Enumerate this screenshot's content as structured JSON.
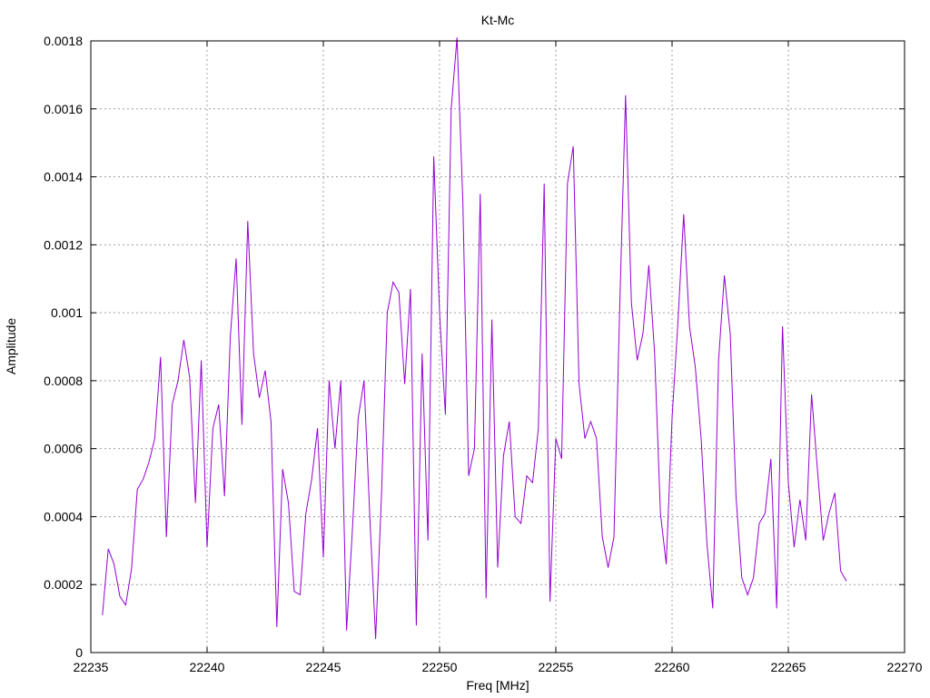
{
  "chart_data": {
    "type": "line",
    "title": "Kt-Mc",
    "xlabel": "Freq [MHz]",
    "ylabel": "Amplitude",
    "xlim": [
      22235,
      22270
    ],
    "ylim": [
      0,
      0.0018
    ],
    "grid": true,
    "x_ticks": [
      "22235",
      "22240",
      "22245",
      "22250",
      "22255",
      "22260",
      "22265",
      "22270"
    ],
    "y_ticks": [
      "0",
      "0.0002",
      "0.0004",
      "0.0006",
      "0.0008",
      "0.001",
      "0.0012",
      "0.0014",
      "0.0016",
      "0.0018"
    ],
    "series": [
      {
        "color": "#9400d3",
        "x": [
          22235.5,
          22235.75,
          22236.0,
          22236.25,
          22236.5,
          22236.75,
          22237.0,
          22237.25,
          22237.5,
          22237.75,
          22238.0,
          22238.25,
          22238.5,
          22238.75,
          22239.0,
          22239.25,
          22239.5,
          22239.75,
          22240.0,
          22240.25,
          22240.5,
          22240.75,
          22241.0,
          22241.25,
          22241.5,
          22241.75,
          22242.0,
          22242.25,
          22242.5,
          22242.75,
          22243.0,
          22243.25,
          22243.5,
          22243.75,
          22244.0,
          22244.25,
          22244.5,
          22244.75,
          22245.0,
          22245.25,
          22245.5,
          22245.75,
          22246.0,
          22246.25,
          22246.5,
          22246.75,
          22247.0,
          22247.25,
          22247.5,
          22247.75,
          22248.0,
          22248.25,
          22248.5,
          22248.75,
          22249.0,
          22249.25,
          22249.5,
          22249.75,
          22250.0,
          22250.25,
          22250.5,
          22250.75,
          22251.0,
          22251.25,
          22251.5,
          22251.75,
          22252.0,
          22252.25,
          22252.5,
          22252.75,
          22253.0,
          22253.25,
          22253.5,
          22253.75,
          22254.0,
          22254.25,
          22254.5,
          22254.75,
          22255.0,
          22255.25,
          22255.5,
          22255.75,
          22256.0,
          22256.25,
          22256.5,
          22256.75,
          22257.0,
          22257.25,
          22257.5,
          22257.75,
          22258.0,
          22258.25,
          22258.5,
          22258.75,
          22259.0,
          22259.25,
          22259.5,
          22259.75,
          22260.0,
          22260.25,
          22260.5,
          22260.75,
          22261.0,
          22261.25,
          22261.5,
          22261.75,
          22262.0,
          22262.25,
          22262.5,
          22262.75,
          22263.0,
          22263.25,
          22263.5,
          22263.75,
          22264.0,
          22264.25,
          22264.5,
          22264.75,
          22265.0,
          22265.25,
          22265.5,
          22265.75,
          22266.0,
          22266.25,
          22266.5,
          22266.75,
          22267.0,
          22267.25,
          22267.5
        ],
        "y": [
          0.00011,
          0.000305,
          0.00026,
          0.000165,
          0.00014,
          0.000245,
          0.00048,
          0.00051,
          0.00056,
          0.00063,
          0.00087,
          0.00034,
          0.00073,
          0.0008,
          0.00092,
          0.00081,
          0.00044,
          0.00086,
          0.00031,
          0.00066,
          0.00073,
          0.00046,
          0.00093,
          0.00116,
          0.00067,
          0.00127,
          0.00088,
          0.00075,
          0.00083,
          0.00068,
          7.5e-05,
          0.00054,
          0.00044,
          0.00018,
          0.00017,
          0.00041,
          0.00051,
          0.00066,
          0.00028,
          0.0008,
          0.0006,
          0.0008,
          6.5e-05,
          0.00036,
          0.00069,
          0.0008,
          0.0004,
          4e-05,
          0.00046,
          0.001,
          0.00109,
          0.00106,
          0.00079,
          0.00107,
          8e-05,
          0.00088,
          0.00033,
          0.00146,
          0.001,
          0.0007,
          0.0016,
          0.00181,
          0.00133,
          0.00052,
          0.0006,
          0.00135,
          0.00016,
          0.00098,
          0.00025,
          0.00058,
          0.00068,
          0.0004,
          0.00038,
          0.00052,
          0.0005,
          0.00066,
          0.00138,
          0.00015,
          0.00063,
          0.00057,
          0.00138,
          0.00149,
          0.00079,
          0.00063,
          0.00068,
          0.00063,
          0.00034,
          0.00025,
          0.00034,
          0.00102,
          0.00164,
          0.00103,
          0.00086,
          0.00094,
          0.00114,
          0.00088,
          0.00041,
          0.00026,
          0.00069,
          0.00097,
          0.00129,
          0.00096,
          0.00084,
          0.00063,
          0.00032,
          0.00013,
          0.00086,
          0.00111,
          0.00094,
          0.00046,
          0.00022,
          0.00017,
          0.00022,
          0.00038,
          0.00041,
          0.00057,
          0.00013,
          0.00096,
          0.0005,
          0.00031,
          0.00045,
          0.00033,
          0.00076,
          0.00054,
          0.00033,
          0.00041,
          0.00047,
          0.00024,
          0.00021
        ]
      }
    ]
  }
}
